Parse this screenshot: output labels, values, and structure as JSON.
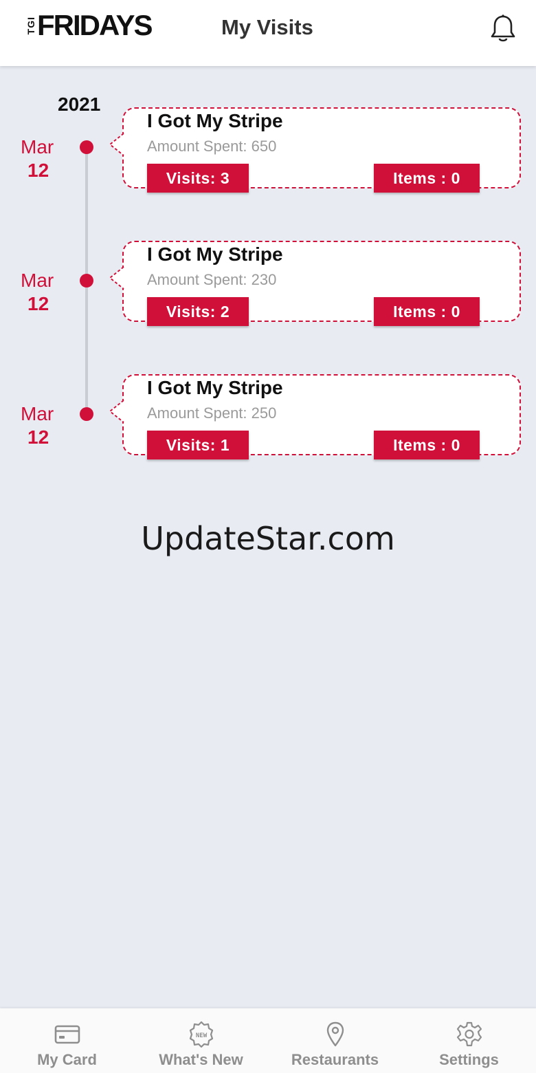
{
  "header": {
    "logo_prefix": "TGI",
    "logo_main": "FRIDAYS",
    "title": "My Visits",
    "bell_icon": "bell-icon"
  },
  "timeline": {
    "year": "2021",
    "visits": [
      {
        "month": "Mar",
        "day": "12",
        "title": "I Got My Stripe",
        "amount": "Amount Spent: 650",
        "visits_label": "Visits: 3",
        "items_label": "Items : 0"
      },
      {
        "month": "Mar",
        "day": "12",
        "title": "I Got My Stripe",
        "amount": "Amount Spent: 230",
        "visits_label": "Visits: 2",
        "items_label": "Items : 0"
      },
      {
        "month": "Mar",
        "day": "12",
        "title": "I Got My Stripe",
        "amount": "Amount Spent: 250",
        "visits_label": "Visits: 1",
        "items_label": "Items : 0"
      }
    ]
  },
  "watermark": "UpdateStar.com",
  "bottom_nav": {
    "items": [
      {
        "label": "My Card",
        "icon": "card-icon"
      },
      {
        "label": "What's New",
        "icon": "new-badge-icon"
      },
      {
        "label": "Restaurants",
        "icon": "location-pin-icon"
      },
      {
        "label": "Settings",
        "icon": "gear-icon"
      }
    ]
  },
  "colors": {
    "accent": "#d1103a",
    "background": "#e8ebf2",
    "nav_label": "#8e8e8e"
  }
}
